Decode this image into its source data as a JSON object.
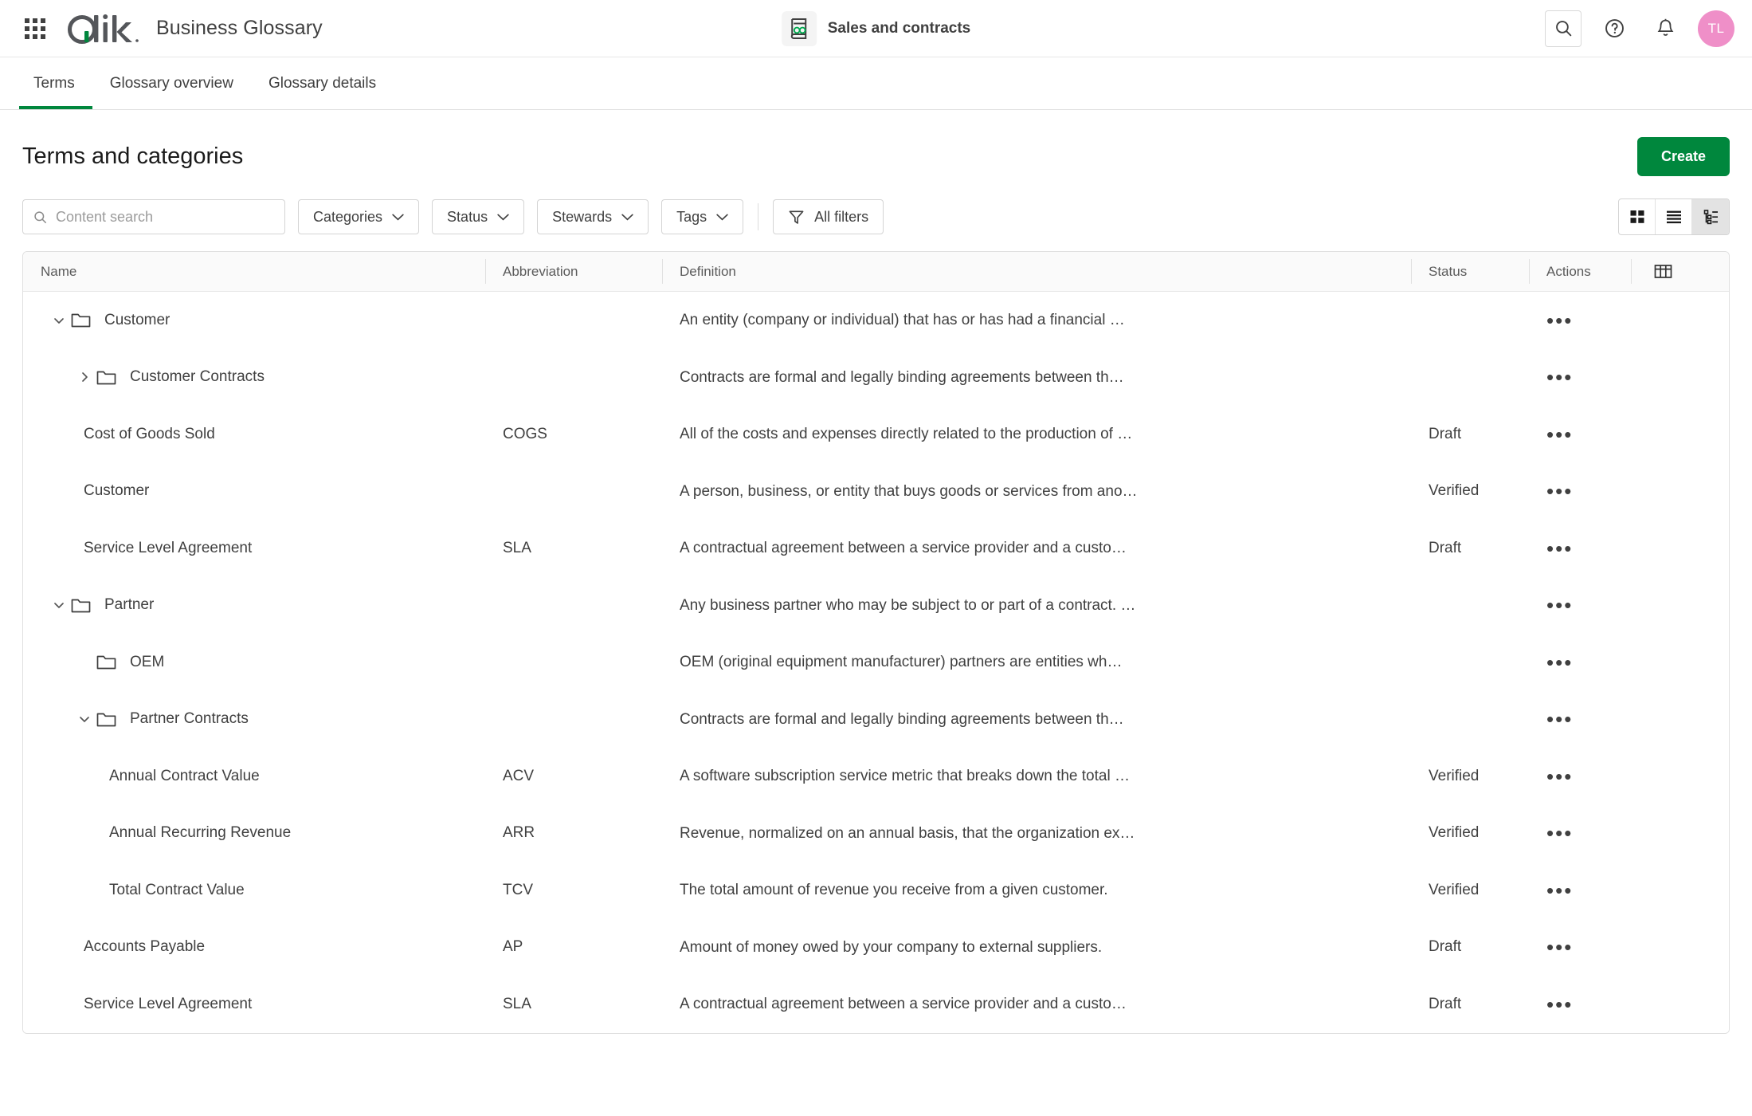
{
  "header": {
    "app_launcher_icon": "grid-apps-icon",
    "brand": "Qlik",
    "app_title": "Business Glossary",
    "glossary_icon": "glossary-book-icon",
    "glossary_name": "Sales and contracts",
    "search_icon": "search-icon",
    "help_icon": "help-circle-icon",
    "notifications_icon": "bell-icon",
    "avatar_initials": "TL",
    "avatar_color": "#ef8fc8"
  },
  "tabs": [
    {
      "label": "Terms",
      "active": true
    },
    {
      "label": "Glossary overview",
      "active": false
    },
    {
      "label": "Glossary details",
      "active": false
    }
  ],
  "page": {
    "title": "Terms and categories",
    "create_label": "Create"
  },
  "toolbar": {
    "search_placeholder": "Content search",
    "search_value": "",
    "search_icon": "search-icon",
    "filters": [
      {
        "label": "Categories",
        "icon": "chevron-down-icon"
      },
      {
        "label": "Status",
        "icon": "chevron-down-icon"
      },
      {
        "label": "Stewards",
        "icon": "chevron-down-icon"
      },
      {
        "label": "Tags",
        "icon": "chevron-down-icon"
      }
    ],
    "all_filters_label": "All filters",
    "all_filters_icon": "filter-funnel-icon",
    "views": [
      {
        "name": "grid-view",
        "icon": "grid-view-icon",
        "selected": false
      },
      {
        "name": "list-view",
        "icon": "list-view-icon",
        "selected": false
      },
      {
        "name": "tree-view",
        "icon": "tree-view-icon",
        "selected": true
      }
    ]
  },
  "table": {
    "columns": [
      "Name",
      "Abbreviation",
      "Definition",
      "Status",
      "Actions"
    ],
    "column_settings_icon": "table-columns-icon",
    "actions_icon": "more-horizontal-icon",
    "rows": [
      {
        "name": "Customer",
        "type": "category",
        "level": 0,
        "expanded": true,
        "abbreviation": "",
        "definition": "An entity (company or individual) that has or has had a financial …",
        "status": "",
        "actions": "•••"
      },
      {
        "name": "Customer Contracts",
        "type": "category",
        "level": 1,
        "expanded": false,
        "abbreviation": "",
        "definition": "Contracts are formal and legally binding agreements between th…",
        "status": "",
        "actions": "•••"
      },
      {
        "name": "Cost of Goods Sold",
        "type": "term",
        "level": 1,
        "abbreviation": "COGS",
        "definition": "All of the costs and expenses directly related to the production of …",
        "status": "Draft",
        "actions": "•••"
      },
      {
        "name": "Customer",
        "type": "term",
        "level": 1,
        "abbreviation": "",
        "definition": "A person, business, or entity that buys goods or services from ano…",
        "status": "Verified",
        "actions": "•••"
      },
      {
        "name": "Service Level Agreement",
        "type": "term",
        "level": 1,
        "abbreviation": "SLA",
        "definition": "A contractual agreement between a service provider and a custo…",
        "status": "Draft",
        "actions": "•••"
      },
      {
        "name": "Partner",
        "type": "category",
        "level": 0,
        "expanded": true,
        "abbreviation": "",
        "definition": "Any business partner who may be subject to or part of a contract. …",
        "status": "",
        "actions": "•••"
      },
      {
        "name": "OEM",
        "type": "category",
        "level": 1,
        "expanded": null,
        "abbreviation": "",
        "definition": "OEM (original equipment manufacturer) partners are entities wh…",
        "status": "",
        "actions": "•••"
      },
      {
        "name": "Partner Contracts",
        "type": "category",
        "level": 1,
        "expanded": true,
        "abbreviation": "",
        "definition": "Contracts are formal and legally binding agreements between th…",
        "status": "",
        "actions": "•••"
      },
      {
        "name": "Annual Contract Value",
        "type": "term",
        "level": 2,
        "abbreviation": "ACV",
        "definition": "A software subscription service metric that breaks down the total …",
        "status": "Verified",
        "actions": "•••"
      },
      {
        "name": "Annual Recurring Revenue",
        "type": "term",
        "level": 2,
        "abbreviation": "ARR",
        "definition": "Revenue, normalized on an annual basis, that the organization ex…",
        "status": "Verified",
        "actions": "•••"
      },
      {
        "name": "Total Contract Value",
        "type": "term",
        "level": 2,
        "abbreviation": "TCV",
        "definition": "The total amount of revenue you receive from a given customer.",
        "status": "Verified",
        "actions": "•••"
      },
      {
        "name": "Accounts Payable",
        "type": "term",
        "level": 1,
        "abbreviation": "AP",
        "definition": "Amount of money owed by your company to external suppliers.",
        "status": "Draft",
        "actions": "•••"
      },
      {
        "name": "Service Level Agreement",
        "type": "term",
        "level": 1,
        "abbreviation": "SLA",
        "definition": "A contractual agreement between a service provider and a custo…",
        "status": "Draft",
        "actions": "•••"
      }
    ]
  },
  "colors": {
    "brand_green": "#00873d",
    "accent_avatar": "#ef8fc8",
    "text": "#404040"
  }
}
